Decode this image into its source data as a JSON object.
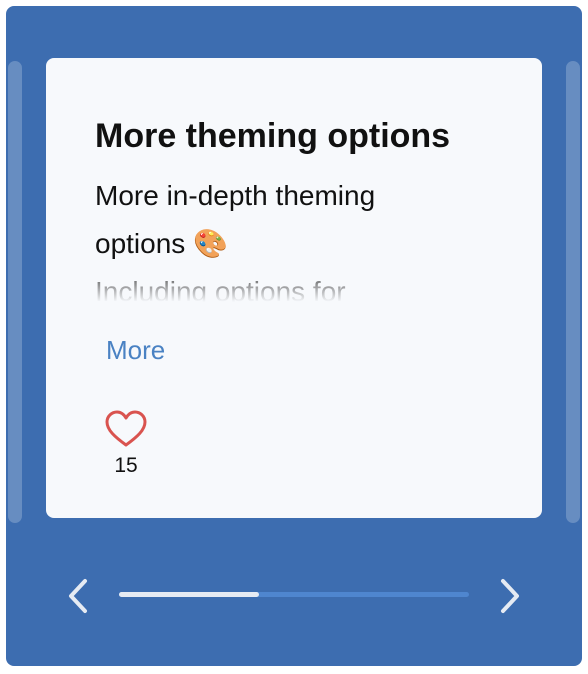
{
  "card": {
    "title": "More theming options",
    "body_line1": "More in-depth theming",
    "body_line2": "options 🎨",
    "body_line3": "Including options for",
    "more_label": "More",
    "like_icon": "heart-icon",
    "like_count": "15"
  },
  "carousel": {
    "prev_icon": "chevron-left-icon",
    "next_icon": "chevron-right-icon",
    "progress_fraction": 0.4
  },
  "colors": {
    "background": "#3d6db0",
    "card": "#f7f9fc",
    "accent": "#4a82c3",
    "heart": "#d9534f",
    "track": "#4f86cf",
    "thumb": "#e6ebf3"
  }
}
